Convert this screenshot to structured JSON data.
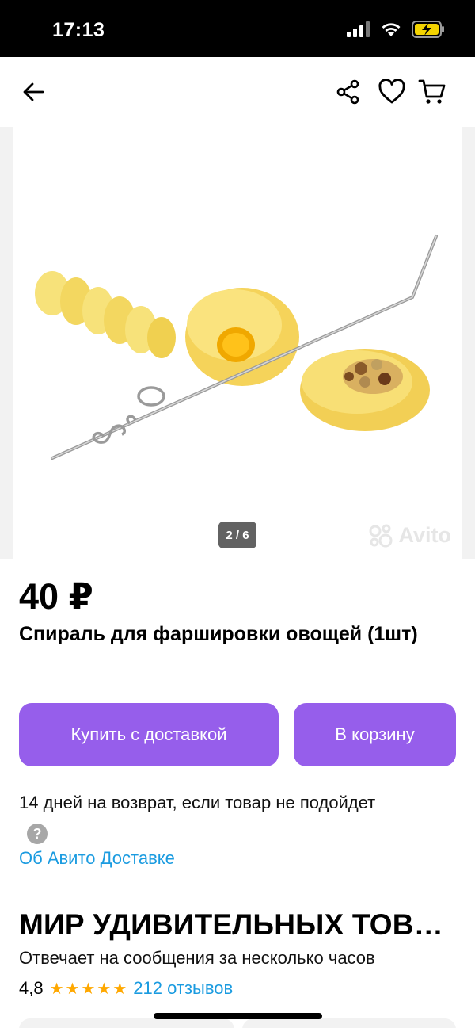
{
  "status_bar": {
    "time": "17:13",
    "icons": [
      "signal-icon",
      "wifi-icon",
      "battery-charging-icon"
    ],
    "battery_color": "#f3d300"
  },
  "nav": {
    "icons": [
      "back-arrow-icon",
      "share-icon",
      "heart-icon",
      "cart-icon"
    ]
  },
  "gallery": {
    "counter": "2 / 6",
    "watermark": "Avito"
  },
  "product": {
    "price": "40 ₽",
    "title": "Спираль для фаршировки овощей (1шт)"
  },
  "actions": {
    "buy_label": "Купить с доставкой",
    "cart_label": "В корзину",
    "accent_color": "#965eeb"
  },
  "delivery": {
    "return_text": "14 дней на возврат, если товар не подойдет",
    "help_symbol": "?",
    "link_text": "Об Авито Доставке"
  },
  "seller": {
    "name": "МИР УДИВИТЕЛЬНЫХ ТОВ…",
    "reply_text": "Отвечает на сообщения за несколько часов",
    "rating": "4,8",
    "stars": 5,
    "reviews": "212 отзывов"
  }
}
